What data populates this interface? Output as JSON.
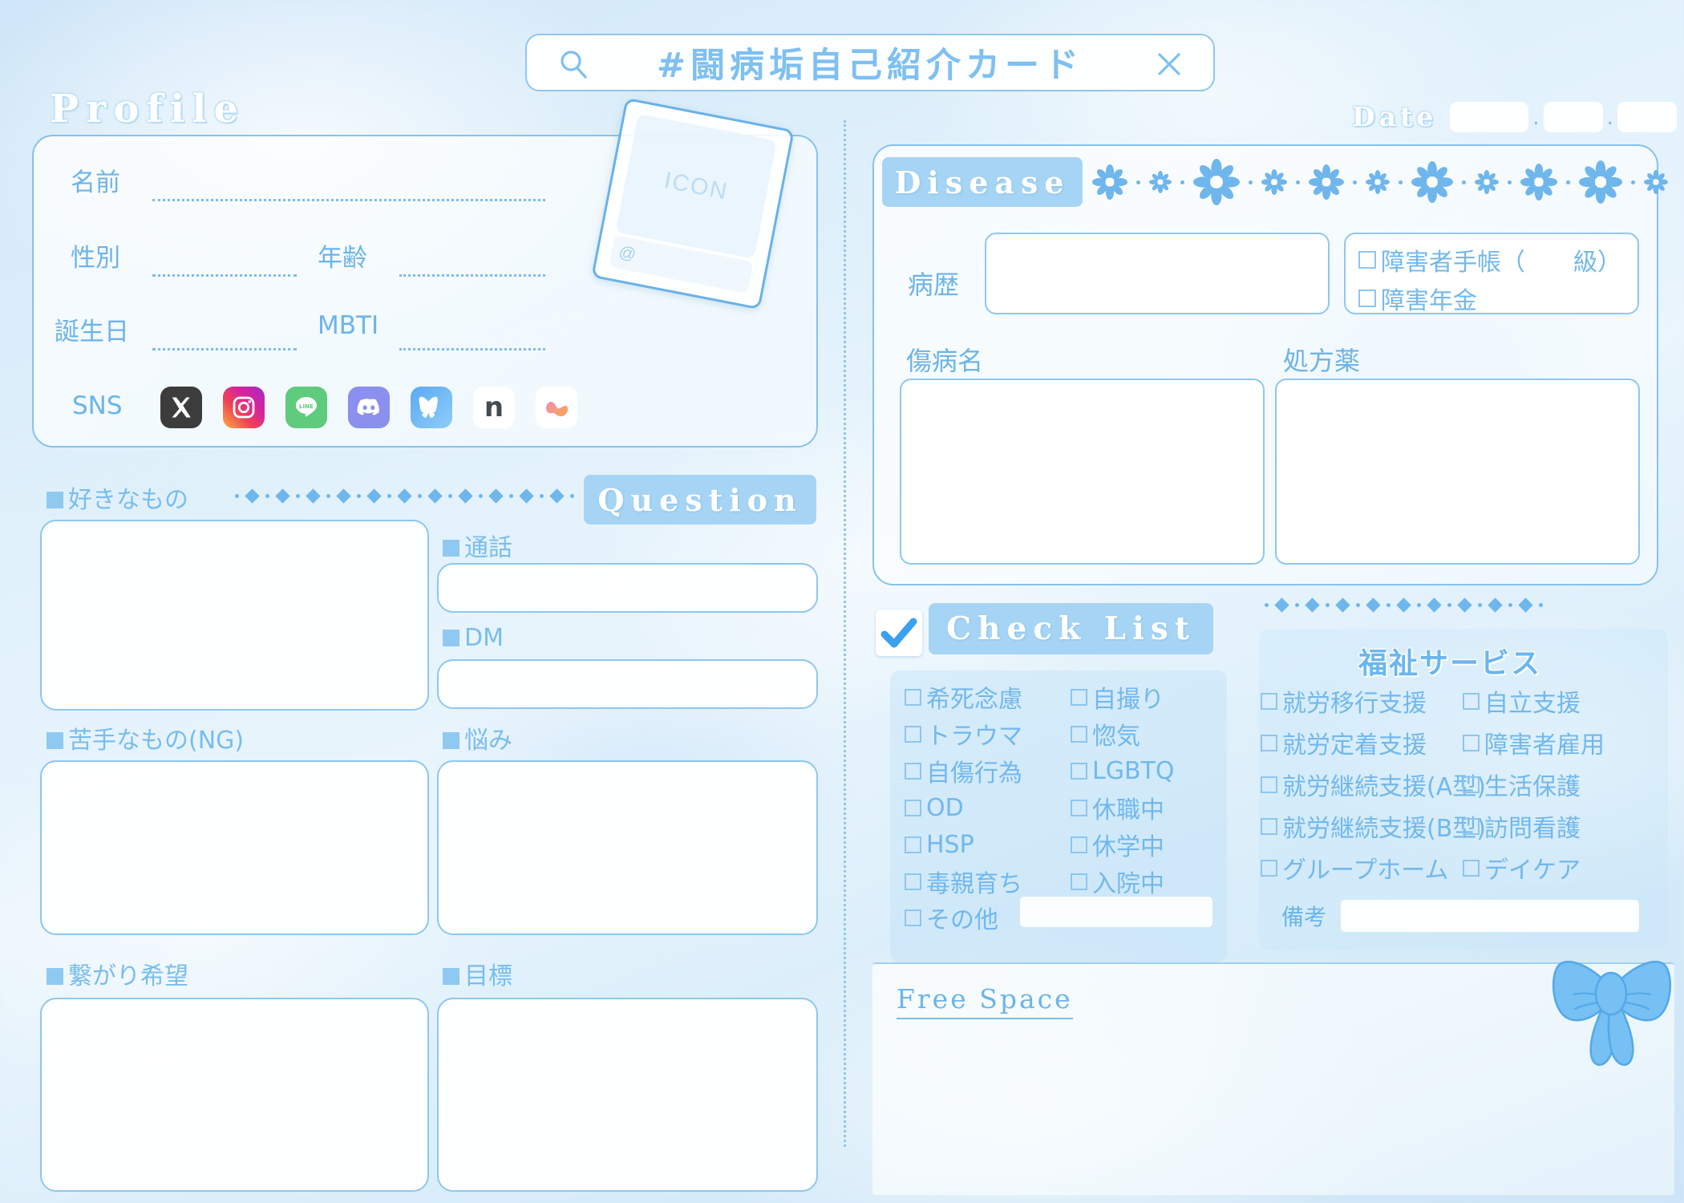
{
  "header": {
    "title": "#闘病垢自己紹介カード",
    "search_icon": "search-icon",
    "close_icon": "close-icon"
  },
  "date": {
    "label": "Date",
    "year": "",
    "month": "",
    "day": "",
    "separator": "."
  },
  "profile": {
    "title": "Profile",
    "fields": [
      {
        "label": "名前",
        "value": ""
      },
      {
        "label": "性別",
        "value": ""
      },
      {
        "label": "年齢",
        "value": ""
      },
      {
        "label": "誕生日",
        "value": ""
      },
      {
        "label": "MBTI",
        "value": ""
      }
    ],
    "sns_label": "SNS",
    "sns_icons": [
      {
        "name": "x-twitter-icon",
        "glyph": "𝕏",
        "bg": "#3c3c3c",
        "fg": "#ffffff"
      },
      {
        "name": "instagram-icon",
        "glyph": "",
        "bg": "#e1306c",
        "fg": "#ffffff"
      },
      {
        "name": "line-icon",
        "glyph": "LINE",
        "bg": "#5ecb7d",
        "fg": "#ffffff"
      },
      {
        "name": "discord-icon",
        "glyph": "",
        "bg": "#8b8fee",
        "fg": "#ffffff"
      },
      {
        "name": "bluesky-icon",
        "glyph": "",
        "bg": "#63b3f5",
        "fg": "#ffffff"
      },
      {
        "name": "note-icon",
        "glyph": "n",
        "bg": "#ffffff",
        "fg": "#444b52"
      },
      {
        "name": "mixi-icon",
        "glyph": "",
        "bg": "#ffffff",
        "fg": "#f09a6a"
      }
    ],
    "icon_placeholder": "ICON",
    "handle_prefix": "@"
  },
  "likes": {
    "heading": "好きなもの",
    "value": ""
  },
  "dislikes": {
    "heading": "苦手なもの(NG)",
    "value": ""
  },
  "connect": {
    "heading": "繋がり希望",
    "value": ""
  },
  "question": {
    "title": "Question",
    "items": [
      {
        "heading": "通話",
        "value": ""
      },
      {
        "heading": "DM",
        "value": ""
      },
      {
        "heading": "悩み",
        "value": ""
      },
      {
        "heading": "目標",
        "value": ""
      }
    ]
  },
  "disease": {
    "title": "Disease",
    "history_label": "病歴",
    "history_value": "",
    "checks": [
      {
        "label": "障害者手帳（　　級）"
      },
      {
        "label": "障害年金"
      }
    ],
    "illness_label": "傷病名",
    "illness_value": "",
    "medicine_label": "処方薬",
    "medicine_value": ""
  },
  "checklist": {
    "title": "Check List",
    "check_icon": "checkmark-icon",
    "col_left": [
      "希死念慮",
      "トラウマ",
      "自傷行為",
      "OD",
      "HSP",
      "毒親育ち"
    ],
    "col_right": [
      "自撮り",
      "惚気",
      "LGBTQ",
      "休職中",
      "休学中",
      "入院中"
    ],
    "other_label": "その他",
    "other_value": ""
  },
  "welfare": {
    "title": "福祉サービス",
    "col_left": [
      "就労移行支援",
      "就労定着支援",
      "就労継続支援(A型)",
      "就労継続支援(B型)",
      "グループホーム"
    ],
    "col_right": [
      "自立支援",
      "障害者雇用",
      "生活保護",
      "訪問看護",
      "デイケア"
    ],
    "note_label": "備考",
    "note_value": ""
  },
  "free_space": {
    "title": "Free Space",
    "value": ""
  },
  "decor": {
    "ribbon": "ribbon-bow-icon",
    "flower_border": "flower-border",
    "diamond_border": "diamond-border"
  },
  "colors": {
    "accent": "#7ec0f2",
    "border": "#8ec7f0",
    "banner": "#a6d4f5",
    "text": "#6cb4ea",
    "bg_light": "#dff0fb"
  }
}
